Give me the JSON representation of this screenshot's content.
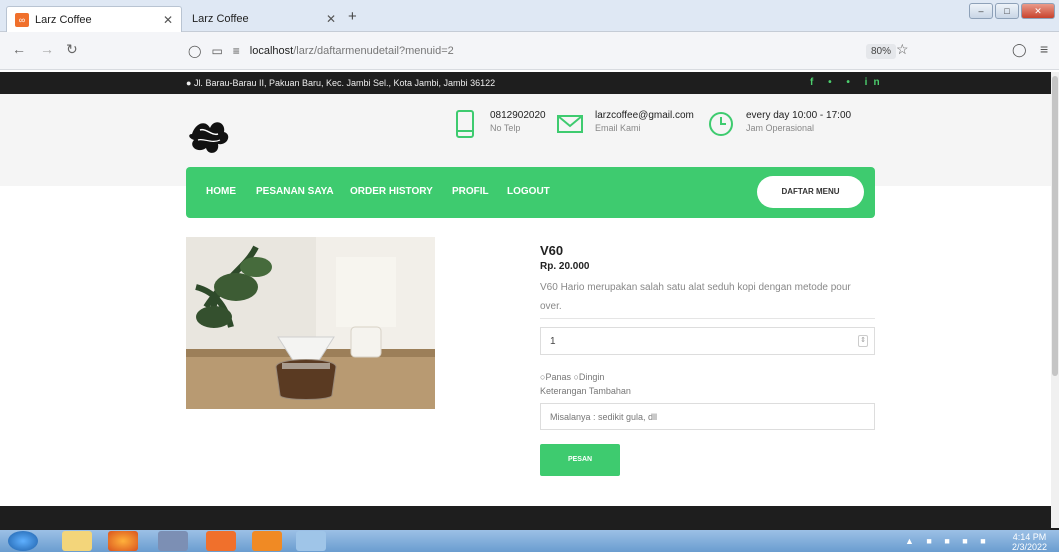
{
  "browser": {
    "tabs": [
      {
        "title": "Larz Coffee"
      },
      {
        "title": "Larz Coffee"
      }
    ],
    "url_host": "localhost",
    "url_path": "/larz/daftarmenudetail?menuid=2",
    "zoom": "80%"
  },
  "site": {
    "address": "Jl. Barau-Barau II, Pakuan Baru, Kec. Jambi Sel., Kota Jambi, Jambi 36122",
    "social": "f • • in",
    "contacts": [
      {
        "line1": "0812902020",
        "line2": "No Telp"
      },
      {
        "line1": "larzcoffee@gmail.com",
        "line2": "Email Kami"
      },
      {
        "line1": "every day 10:00 - 17:00",
        "line2": "Jam Operasional"
      }
    ],
    "nav": [
      "HOME",
      "PESANAN SAYA",
      "ORDER HISTORY",
      "PROFIL",
      "LOGOUT"
    ],
    "daftar_menu": "DAFTAR MENU",
    "accent": "#3ecb6f"
  },
  "product": {
    "name": "V60",
    "price": "Rp. 20.000",
    "description": "V60 Hario merupakan salah satu alat seduh kopi dengan metode pour over.",
    "quantity": "1",
    "option_hot": "Panas",
    "option_cold": "Dingin",
    "notes_label": "Keterangan Tambahan",
    "notes_placeholder": "Misalanya : sedikit gula, dll",
    "order_button": "PESAN"
  },
  "taskbar": {
    "time": "4:14 PM",
    "date": "2/3/2022"
  }
}
